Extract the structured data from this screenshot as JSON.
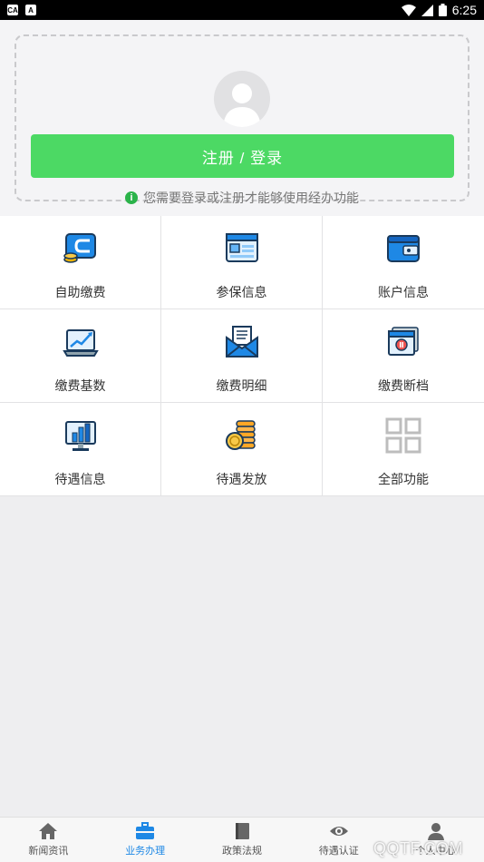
{
  "status_bar": {
    "time": "6:25"
  },
  "login": {
    "button_label": "注册 / 登录",
    "hint": "您需要登录或注册才能够使用经办功能"
  },
  "grid": [
    {
      "label": "自助缴费",
      "icon": "wallet-card-icon"
    },
    {
      "label": "参保信息",
      "icon": "browser-window-icon"
    },
    {
      "label": "账户信息",
      "icon": "wallet-icon"
    },
    {
      "label": "缴费基数",
      "icon": "laptop-chart-icon"
    },
    {
      "label": "缴费明细",
      "icon": "envelope-letter-icon"
    },
    {
      "label": "缴费断档",
      "icon": "video-card-icon"
    },
    {
      "label": "待遇信息",
      "icon": "monitor-bar-chart-icon"
    },
    {
      "label": "待遇发放",
      "icon": "coin-stack-icon"
    },
    {
      "label": "全部功能",
      "icon": "grid-squares-icon"
    }
  ],
  "tabs": [
    {
      "label": "新闻资讯",
      "icon": "home-icon"
    },
    {
      "label": "业务办理",
      "icon": "briefcase-icon",
      "active": true
    },
    {
      "label": "政策法规",
      "icon": "book-icon"
    },
    {
      "label": "待遇认证",
      "icon": "eye-icon"
    },
    {
      "label": "个人中心",
      "icon": "person-icon"
    }
  ],
  "watermark": "QQTF.COM",
  "colors": {
    "accent_green": "#4cd964",
    "active_tab": "#1e88e5"
  }
}
